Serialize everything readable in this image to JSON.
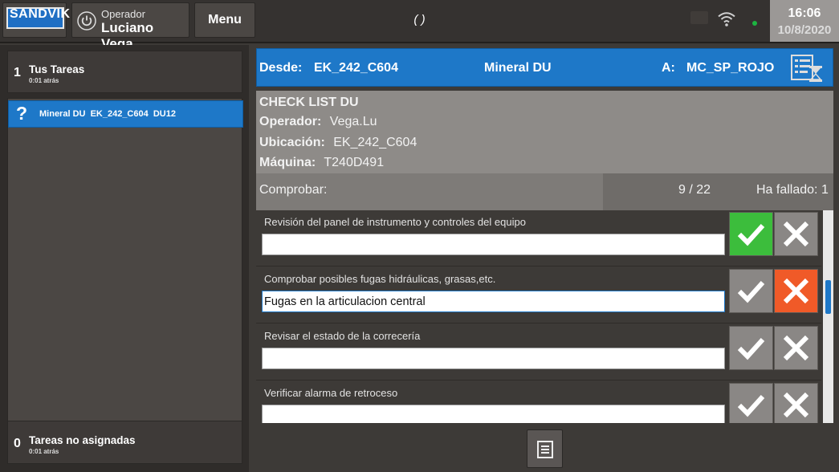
{
  "header": {
    "logo_text": "SANDVIK",
    "operator_label": "Operador",
    "operator_name": "Luciano Vega",
    "menu_label": "Menu",
    "center_status": "( )",
    "clock_time": "16:06",
    "clock_date": "10/8/2020"
  },
  "sidebar": {
    "my_tasks": {
      "count": "1",
      "title": "Tus Tareas",
      "subtitle": "0:01 atrás"
    },
    "task_item": {
      "icon": "?",
      "label": "Mineral DU  EK_242_C604  DU12"
    },
    "unassigned": {
      "count": "0",
      "title": "Tareas no asignadas",
      "subtitle": "0:01 atrás"
    }
  },
  "route": {
    "from_label": "Desde:",
    "from_value": "EK_242_C604",
    "material": "Mineral DU",
    "to_label": "A:",
    "to_value": "MC_SP_ROJO"
  },
  "checklist": {
    "title": "CHECK LIST DU",
    "operator_label": "Operador:",
    "operator_value": "Vega.Lu",
    "location_label": "Ubicación:",
    "location_value": "EK_242_C604",
    "machine_label": "Máquina:",
    "machine_value": "T240D491",
    "check_label": "Comprobar:",
    "counter": "9  /  22",
    "failed": "Ha fallado:  1"
  },
  "items": [
    {
      "label": "Revisión del panel de instrumento y controles del equipo",
      "value": "",
      "status": "ok"
    },
    {
      "label": "Comprobar posibles fugas hidráulicas, grasas,etc.",
      "value": "Fugas en la articulacion central",
      "status": "fail"
    },
    {
      "label": "Revisar el estado de la correcería",
      "value": "",
      "status": "none"
    },
    {
      "label": "Verificar alarma de retroceso",
      "value": "",
      "status": "none"
    }
  ],
  "colors": {
    "accent_blue": "#1e78c8",
    "ok_green": "#3cbd3c",
    "fail_orange": "#f05a28",
    "status_green": "#1db541"
  }
}
